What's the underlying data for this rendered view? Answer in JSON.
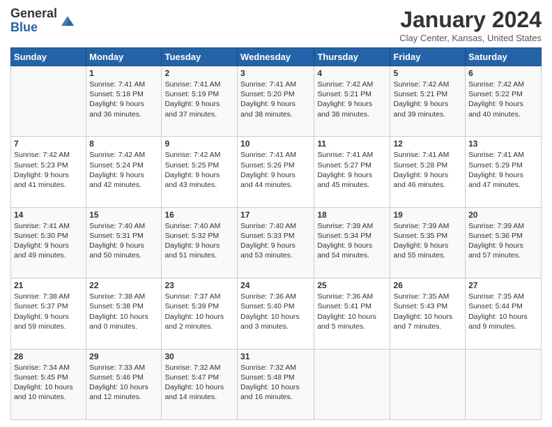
{
  "header": {
    "logo_general": "General",
    "logo_blue": "Blue",
    "month_title": "January 2024",
    "location": "Clay Center, Kansas, United States"
  },
  "days_of_week": [
    "Sunday",
    "Monday",
    "Tuesday",
    "Wednesday",
    "Thursday",
    "Friday",
    "Saturday"
  ],
  "weeks": [
    [
      {
        "day": "",
        "info": ""
      },
      {
        "day": "1",
        "info": "Sunrise: 7:41 AM\nSunset: 5:18 PM\nDaylight: 9 hours\nand 36 minutes."
      },
      {
        "day": "2",
        "info": "Sunrise: 7:41 AM\nSunset: 5:19 PM\nDaylight: 9 hours\nand 37 minutes."
      },
      {
        "day": "3",
        "info": "Sunrise: 7:41 AM\nSunset: 5:20 PM\nDaylight: 9 hours\nand 38 minutes."
      },
      {
        "day": "4",
        "info": "Sunrise: 7:42 AM\nSunset: 5:21 PM\nDaylight: 9 hours\nand 38 minutes."
      },
      {
        "day": "5",
        "info": "Sunrise: 7:42 AM\nSunset: 5:21 PM\nDaylight: 9 hours\nand 39 minutes."
      },
      {
        "day": "6",
        "info": "Sunrise: 7:42 AM\nSunset: 5:22 PM\nDaylight: 9 hours\nand 40 minutes."
      }
    ],
    [
      {
        "day": "7",
        "info": "Sunrise: 7:42 AM\nSunset: 5:23 PM\nDaylight: 9 hours\nand 41 minutes."
      },
      {
        "day": "8",
        "info": "Sunrise: 7:42 AM\nSunset: 5:24 PM\nDaylight: 9 hours\nand 42 minutes."
      },
      {
        "day": "9",
        "info": "Sunrise: 7:42 AM\nSunset: 5:25 PM\nDaylight: 9 hours\nand 43 minutes."
      },
      {
        "day": "10",
        "info": "Sunrise: 7:41 AM\nSunset: 5:26 PM\nDaylight: 9 hours\nand 44 minutes."
      },
      {
        "day": "11",
        "info": "Sunrise: 7:41 AM\nSunset: 5:27 PM\nDaylight: 9 hours\nand 45 minutes."
      },
      {
        "day": "12",
        "info": "Sunrise: 7:41 AM\nSunset: 5:28 PM\nDaylight: 9 hours\nand 46 minutes."
      },
      {
        "day": "13",
        "info": "Sunrise: 7:41 AM\nSunset: 5:29 PM\nDaylight: 9 hours\nand 47 minutes."
      }
    ],
    [
      {
        "day": "14",
        "info": "Sunrise: 7:41 AM\nSunset: 5:30 PM\nDaylight: 9 hours\nand 49 minutes."
      },
      {
        "day": "15",
        "info": "Sunrise: 7:40 AM\nSunset: 5:31 PM\nDaylight: 9 hours\nand 50 minutes."
      },
      {
        "day": "16",
        "info": "Sunrise: 7:40 AM\nSunset: 5:32 PM\nDaylight: 9 hours\nand 51 minutes."
      },
      {
        "day": "17",
        "info": "Sunrise: 7:40 AM\nSunset: 5:33 PM\nDaylight: 9 hours\nand 53 minutes."
      },
      {
        "day": "18",
        "info": "Sunrise: 7:39 AM\nSunset: 5:34 PM\nDaylight: 9 hours\nand 54 minutes."
      },
      {
        "day": "19",
        "info": "Sunrise: 7:39 AM\nSunset: 5:35 PM\nDaylight: 9 hours\nand 55 minutes."
      },
      {
        "day": "20",
        "info": "Sunrise: 7:39 AM\nSunset: 5:36 PM\nDaylight: 9 hours\nand 57 minutes."
      }
    ],
    [
      {
        "day": "21",
        "info": "Sunrise: 7:38 AM\nSunset: 5:37 PM\nDaylight: 9 hours\nand 59 minutes."
      },
      {
        "day": "22",
        "info": "Sunrise: 7:38 AM\nSunset: 5:38 PM\nDaylight: 10 hours\nand 0 minutes."
      },
      {
        "day": "23",
        "info": "Sunrise: 7:37 AM\nSunset: 5:39 PM\nDaylight: 10 hours\nand 2 minutes."
      },
      {
        "day": "24",
        "info": "Sunrise: 7:36 AM\nSunset: 5:40 PM\nDaylight: 10 hours\nand 3 minutes."
      },
      {
        "day": "25",
        "info": "Sunrise: 7:36 AM\nSunset: 5:41 PM\nDaylight: 10 hours\nand 5 minutes."
      },
      {
        "day": "26",
        "info": "Sunrise: 7:35 AM\nSunset: 5:43 PM\nDaylight: 10 hours\nand 7 minutes."
      },
      {
        "day": "27",
        "info": "Sunrise: 7:35 AM\nSunset: 5:44 PM\nDaylight: 10 hours\nand 9 minutes."
      }
    ],
    [
      {
        "day": "28",
        "info": "Sunrise: 7:34 AM\nSunset: 5:45 PM\nDaylight: 10 hours\nand 10 minutes."
      },
      {
        "day": "29",
        "info": "Sunrise: 7:33 AM\nSunset: 5:46 PM\nDaylight: 10 hours\nand 12 minutes."
      },
      {
        "day": "30",
        "info": "Sunrise: 7:32 AM\nSunset: 5:47 PM\nDaylight: 10 hours\nand 14 minutes."
      },
      {
        "day": "31",
        "info": "Sunrise: 7:32 AM\nSunset: 5:48 PM\nDaylight: 10 hours\nand 16 minutes."
      },
      {
        "day": "",
        "info": ""
      },
      {
        "day": "",
        "info": ""
      },
      {
        "day": "",
        "info": ""
      }
    ]
  ]
}
